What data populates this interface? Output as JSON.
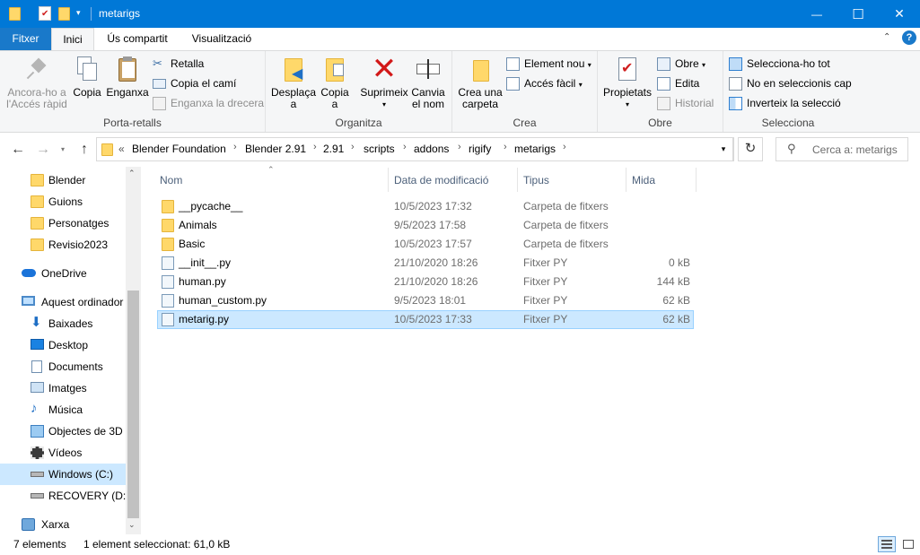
{
  "window": {
    "title": "metarigs",
    "minimize": "—",
    "maximize": "☐",
    "close": "✕"
  },
  "ribbon_tabs": [
    "Fitxer",
    "Inici",
    "Ús compartit",
    "Visualització"
  ],
  "ribbon": {
    "groups": {
      "porta_retalls": "Porta-retalls",
      "organitza": "Organitza",
      "crea": "Crea",
      "obre": "Obre",
      "selecciona": "Selecciona"
    },
    "pin_quick_access": [
      "Ancora-ho a",
      "l'Accés ràpid"
    ],
    "copy": "Copia",
    "paste": "Enganxa",
    "cut": "Retalla",
    "copy_path": "Copia el camí",
    "paste_shortcut": "Enganxa la drecera",
    "move_to": [
      "Desplaça",
      "a"
    ],
    "copy_to": [
      "Copia",
      "a"
    ],
    "delete": "Suprimeix",
    "rename": [
      "Canvia",
      "el nom"
    ],
    "new_folder": [
      "Crea una",
      "carpeta"
    ],
    "new_item": "Element nou",
    "easy_access": "Accés fàcil",
    "properties": "Propietats",
    "open": "Obre",
    "edit": "Edita",
    "history": "Historial",
    "select_all": "Selecciona-ho tot",
    "select_none": "No en seleccionis cap",
    "invert_selection": "Inverteix la selecció"
  },
  "address": {
    "overflow": "«",
    "crumbs": [
      "Blender Foundation",
      "Blender 2.91",
      "2.91",
      "scripts",
      "addons",
      "rigify",
      "metarigs"
    ],
    "search_placeholder": "Cerca a: metarigs"
  },
  "nav_pane": {
    "items": [
      {
        "label": "Blender",
        "icon": "folder-icon"
      },
      {
        "label": "Guions",
        "icon": "folder-icon"
      },
      {
        "label": "Personatges",
        "icon": "folder-icon"
      },
      {
        "label": "Revisio2023",
        "icon": "folder-icon"
      },
      {
        "label": "OneDrive",
        "icon": "cloud-icon"
      },
      {
        "label": "Aquest ordinador",
        "icon": "computer-icon"
      },
      {
        "label": "Baixades",
        "icon": "download-icon"
      },
      {
        "label": "Desktop",
        "icon": "desktop-icon"
      },
      {
        "label": "Documents",
        "icon": "document-icon"
      },
      {
        "label": "Imatges",
        "icon": "pictures-icon"
      },
      {
        "label": "Música",
        "icon": "music-icon"
      },
      {
        "label": "Objectes de 3D",
        "icon": "cube-icon"
      },
      {
        "label": "Vídeos",
        "icon": "video-icon"
      },
      {
        "label": "Windows (C:)",
        "icon": "drive-icon"
      },
      {
        "label": "RECOVERY (D:)",
        "icon": "drive-icon"
      },
      {
        "label": "Xarxa",
        "icon": "network-icon"
      }
    ]
  },
  "columns": [
    "Nom",
    "Data de modificació",
    "Tipus",
    "Mida"
  ],
  "files": [
    {
      "name": "__pycache__",
      "date": "10/5/2023 17:32",
      "type": "Carpeta de fitxers",
      "size": "",
      "kind": "folder"
    },
    {
      "name": "Animals",
      "date": "9/5/2023 17:58",
      "type": "Carpeta de fitxers",
      "size": "",
      "kind": "folder"
    },
    {
      "name": "Basic",
      "date": "10/5/2023 17:57",
      "type": "Carpeta de fitxers",
      "size": "",
      "kind": "folder"
    },
    {
      "name": "__init__.py",
      "date": "21/10/2020 18:26",
      "type": "Fitxer PY",
      "size": "0 kB",
      "kind": "py"
    },
    {
      "name": "human.py",
      "date": "21/10/2020 18:26",
      "type": "Fitxer PY",
      "size": "144 kB",
      "kind": "py"
    },
    {
      "name": "human_custom.py",
      "date": "9/5/2023 18:01",
      "type": "Fitxer PY",
      "size": "62 kB",
      "kind": "py"
    },
    {
      "name": "metarig.py",
      "date": "10/5/2023 17:33",
      "type": "Fitxer PY",
      "size": "62 kB",
      "kind": "py",
      "selected": true
    }
  ],
  "status": {
    "count": "7 elements",
    "selection": "1 element seleccionat: 61,0 kB"
  },
  "colors": {
    "titlebar": "#0078d7",
    "file_tab": "#1979ca",
    "selection": "#cce8ff",
    "folder": "#ffd86a"
  }
}
